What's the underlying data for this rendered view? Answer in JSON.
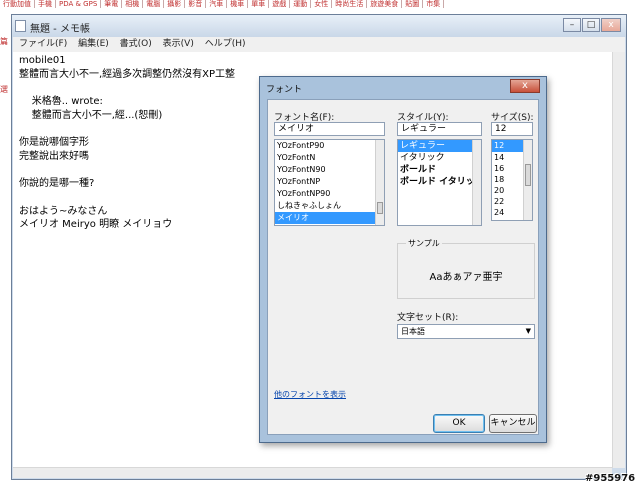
{
  "forum_nav": [
    "行動加值",
    "手機",
    "PDA & GPS",
    "筆電",
    "相機",
    "電腦",
    "攝影",
    "影音",
    "汽車",
    "機車",
    "單車",
    "遊戲",
    "運動",
    "女性",
    "時尚生活",
    "旅遊美食",
    "貼圖",
    "市集"
  ],
  "left_stubs": [
    "篇",
    "選"
  ],
  "notepad": {
    "title": "無題 - メモ帳",
    "menu": [
      "ファイル(F)",
      "編集(E)",
      "書式(O)",
      "表示(V)",
      "ヘルプ(H)"
    ],
    "lines": [
      "mobile01",
      "整體而言大小不一,經過多次調整仍然沒有XP工整",
      "",
      "    米格魯.. wrote:",
      "    整體而言大小不一,經...(恕刪)",
      "",
      "你是說哪個字形",
      "完整說出來好嗎",
      "",
      "你說的是哪一種?",
      "",
      "おはよう~みなさん",
      "メイリオ Meiryo 明瞭 メイリョウ"
    ]
  },
  "dialog": {
    "title": "フォント",
    "close": "x",
    "font_label": "フォント名(F):",
    "font_value": "メイリオ",
    "fonts": [
      "YOzFontP90",
      "YOzFontN",
      "YOzFontN90",
      "YOzFontNP",
      "YOzFontNP90",
      "しねきゃふしょん",
      "メイリオ"
    ],
    "style_label": "スタイル(Y):",
    "style_value": "レギュラー",
    "styles": [
      "レギュラー",
      "イタリック",
      "ボールド",
      "ボールド イタリック"
    ],
    "size_label": "サイズ(S):",
    "size_value": "12",
    "sizes": [
      "12",
      "14",
      "16",
      "18",
      "20",
      "22",
      "24"
    ],
    "sample_label": "サンプル",
    "sample_text": "Aaあぁアァ亜宇",
    "charset_label": "文字セット(R):",
    "charset_value": "日本語",
    "more_fonts": "他のフォントを表示",
    "ok": "OK",
    "cancel": "キャンセル"
  },
  "watermark": "#955976"
}
